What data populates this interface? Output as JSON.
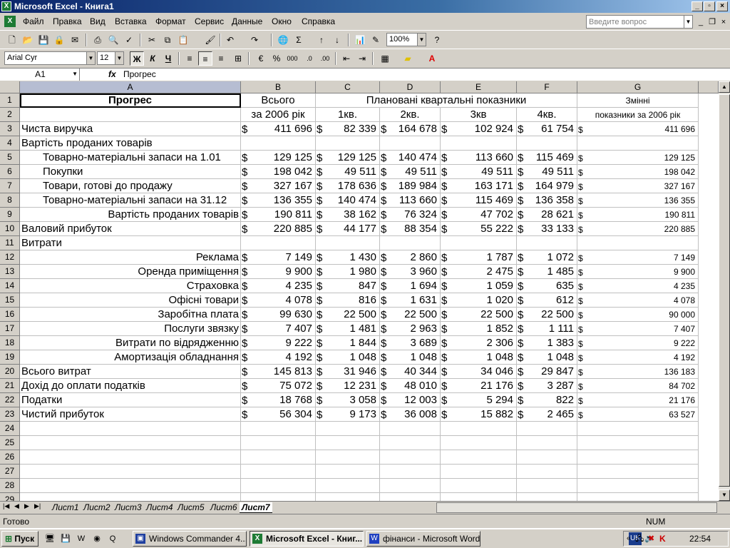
{
  "window": {
    "title": "Microsoft Excel - Книга1"
  },
  "menu": {
    "items": [
      "Файл",
      "Правка",
      "Вид",
      "Вставка",
      "Формат",
      "Сервис",
      "Данные",
      "Окно",
      "Справка"
    ],
    "help_placeholder": "Введите вопрос"
  },
  "toolbar": {
    "zoom": "100%",
    "font": "Arial Cyr",
    "size": "12",
    "bold": "Ж",
    "italic": "К",
    "underline": "Ч"
  },
  "formula": {
    "cell_ref": "A1",
    "fx": "fx",
    "value": "Прогрес"
  },
  "columns": [
    "A",
    "B",
    "C",
    "D",
    "E",
    "F",
    "G"
  ],
  "rows": [
    "1",
    "2",
    "3",
    "4",
    "5",
    "6",
    "7",
    "8",
    "9",
    "10",
    "11",
    "12",
    "13",
    "14",
    "15",
    "16",
    "17",
    "18",
    "19",
    "20",
    "21",
    "22",
    "23",
    "24",
    "25",
    "26",
    "27",
    "28",
    "29"
  ],
  "headers": {
    "a1": "Прогрес",
    "b1": "Всього",
    "cf1": "Плановані квартальні показники",
    "g1": "Змінні",
    "b2": "за 2006 рік",
    "c2": "1кв.",
    "d2": "2кв.",
    "e2": "3кв",
    "f2": "4кв.",
    "g2": "показники за 2006 рік"
  },
  "currency": "$",
  "table": [
    {
      "label": "Чиста виручка",
      "align": "left",
      "b": "411 696",
      "c": "82 339",
      "d": "164 678",
      "e": "102 924",
      "f": "61 754",
      "g": "411 696"
    },
    {
      "label": "Вартість проданих товарів",
      "align": "left"
    },
    {
      "label": "Товарно-матеріальні запаси на 1.01",
      "align": "indent",
      "b": "129 125",
      "c": "129 125",
      "d": "140 474",
      "e": "113 660",
      "f": "115 469",
      "g": "129 125"
    },
    {
      "label": "Покупки",
      "align": "indent",
      "b": "198 042",
      "c": "49 511",
      "d": "49 511",
      "e": "49 511",
      "f": "49 511",
      "g": "198 042"
    },
    {
      "label": "Товари, готові до продажу",
      "align": "indent",
      "b": "327 167",
      "c": "178 636",
      "d": "189 984",
      "e": "163 171",
      "f": "164 979",
      "g": "327 167"
    },
    {
      "label": "Товарно-матеріальні запаси на 31.12",
      "align": "indent",
      "b": "136 355",
      "c": "140 474",
      "d": "113 660",
      "e": "115 469",
      "f": "136 358",
      "g": "136 355"
    },
    {
      "label": "Вартість проданих товарів",
      "align": "right",
      "b": "190 811",
      "c": "38 162",
      "d": "76 324",
      "e": "47 702",
      "f": "28 621",
      "g": "190 811"
    },
    {
      "label": "Валовий прибуток",
      "align": "left",
      "b": "220 885",
      "c": "44 177",
      "d": "88 354",
      "e": "55 222",
      "f": "33 133",
      "g": "220 885"
    },
    {
      "label": "Витрати",
      "align": "left"
    },
    {
      "label": "Реклама",
      "align": "right",
      "b": "7 149",
      "c": "1 430",
      "d": "2 860",
      "e": "1 787",
      "f": "1 072",
      "g": "7 149"
    },
    {
      "label": "Оренда приміщення",
      "align": "right",
      "b": "9 900",
      "c": "1 980",
      "d": "3 960",
      "e": "2 475",
      "f": "1 485",
      "g": "9 900"
    },
    {
      "label": "Страховка",
      "align": "right",
      "b": "4 235",
      "c": "847",
      "d": "1 694",
      "e": "1 059",
      "f": "635",
      "g": "4 235"
    },
    {
      "label": "Офісні товари",
      "align": "right",
      "b": "4 078",
      "c": "816",
      "d": "1 631",
      "e": "1 020",
      "f": "612",
      "g": "4 078"
    },
    {
      "label": "Заробітна плата",
      "align": "right",
      "b": "99 630",
      "c": "22 500",
      "d": "22 500",
      "e": "22 500",
      "f": "22 500",
      "g": "90 000"
    },
    {
      "label": "Послуги звязку",
      "align": "right",
      "b": "7 407",
      "c": "1 481",
      "d": "2 963",
      "e": "1 852",
      "f": "1 111",
      "g": "7 407"
    },
    {
      "label": "Витрати по відрядженню",
      "align": "right",
      "b": "9 222",
      "c": "1 844",
      "d": "3 689",
      "e": "2 306",
      "f": "1 383",
      "g": "9 222"
    },
    {
      "label": "Амортизація обладнання",
      "align": "right",
      "b": "4 192",
      "c": "1 048",
      "d": "1 048",
      "e": "1 048",
      "f": "1 048",
      "g": "4 192"
    },
    {
      "label": "Всього витрат",
      "align": "left",
      "b": "145 813",
      "c": "31 946",
      "d": "40 344",
      "e": "34 046",
      "f": "29 847",
      "g": "136 183"
    },
    {
      "label": "Дохід до оплати податків",
      "align": "left",
      "b": "75 072",
      "c": "12 231",
      "d": "48 010",
      "e": "21 176",
      "f": "3 287",
      "g": "84 702"
    },
    {
      "label": "Податки",
      "align": "left",
      "b": "18 768",
      "c": "3 058",
      "d": "12 003",
      "e": "5 294",
      "f": "822",
      "g": "21 176"
    },
    {
      "label": "Чистий прибуток",
      "align": "left",
      "b": "56 304",
      "c": "9 173",
      "d": "36 008",
      "e": "15 882",
      "f": "2 465",
      "g": "63 527"
    }
  ],
  "sheets": [
    "Лист1",
    "Лист2",
    "Лист3",
    "Лист4",
    "Лист5",
    "Лист6",
    "Лист7"
  ],
  "status": {
    "left": "Готово",
    "num": "NUM"
  },
  "taskbar": {
    "start": "Пуск",
    "tasks": [
      "Windows Commander 4....",
      "Microsoft Excel - Книг...",
      "фінанси - Microsoft Word"
    ],
    "lang": "UK",
    "clock": "22:54"
  }
}
